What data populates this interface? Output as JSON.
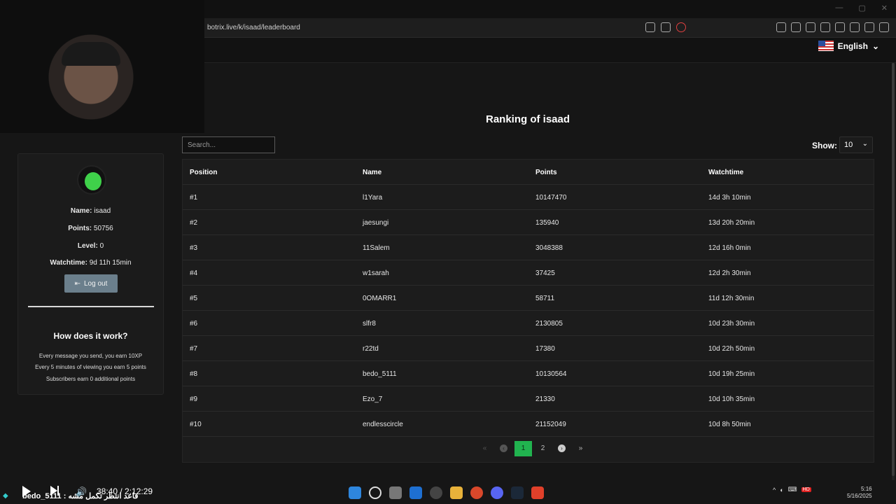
{
  "browser": {
    "url": "botrix.live/k/isaad/leaderboard"
  },
  "header": {
    "language": "English"
  },
  "profile": {
    "name_label": "Name:",
    "name": "isaad",
    "points_label": "Points:",
    "points": "50756",
    "level_label": "Level:",
    "level": "0",
    "watchtime_label": "Watchtime:",
    "watchtime": "9d 11h 15min",
    "logout_label": "Log out",
    "how_title": "How does it work?",
    "how_lines": [
      "Every message you send, you earn 10XP",
      "Every 5 minutes of viewing you earn 5 points",
      "Subscribers earn 0 additional points"
    ]
  },
  "main": {
    "title": "Ranking of isaad",
    "search_placeholder": "Search...",
    "show_label": "Show:",
    "show_value": "10",
    "columns": [
      "Position",
      "Name",
      "Points",
      "Watchtime"
    ],
    "rows": [
      [
        "#1",
        "l1Yara",
        "10147470",
        "14d 3h 10min"
      ],
      [
        "#2",
        "jaesungi",
        "135940",
        "13d 20h 20min"
      ],
      [
        "#3",
        "11Salem",
        "3048388",
        "12d 16h 0min"
      ],
      [
        "#4",
        "w1sarah",
        "37425",
        "12d 2h 30min"
      ],
      [
        "#5",
        "0OMARR1",
        "58711",
        "11d 12h 30min"
      ],
      [
        "#6",
        "slfr8",
        "2130805",
        "10d 23h 30min"
      ],
      [
        "#7",
        "r22td",
        "17380",
        "10d 22h 50min"
      ],
      [
        "#8",
        "bedo_5111",
        "10130564",
        "10d 19h 25min"
      ],
      [
        "#9",
        "Ezo_7",
        "21330",
        "10d 10h 35min"
      ],
      [
        "#10",
        "endlesscircle",
        "21152049",
        "10d 8h 50min"
      ]
    ],
    "pager": {
      "first": "«",
      "prev": "‹",
      "pages": [
        "1",
        "2"
      ],
      "current": "1",
      "next": "›",
      "last": "»"
    }
  },
  "overlay": {
    "video_time": "38:40 / 2:12:29",
    "chat_line": "bedo_5111 : قاعد انتظر تكمل مشه",
    "clock_time": "5:16",
    "clock_date": "5/16/2025",
    "tray_badge": "HD"
  },
  "colors": {
    "accent_green": "#21b34f",
    "logout_button": "#6b7f8c",
    "background": "#161616"
  },
  "icons": {
    "logout": "sign-out-icon",
    "language_flag": "us-flag-icon"
  }
}
